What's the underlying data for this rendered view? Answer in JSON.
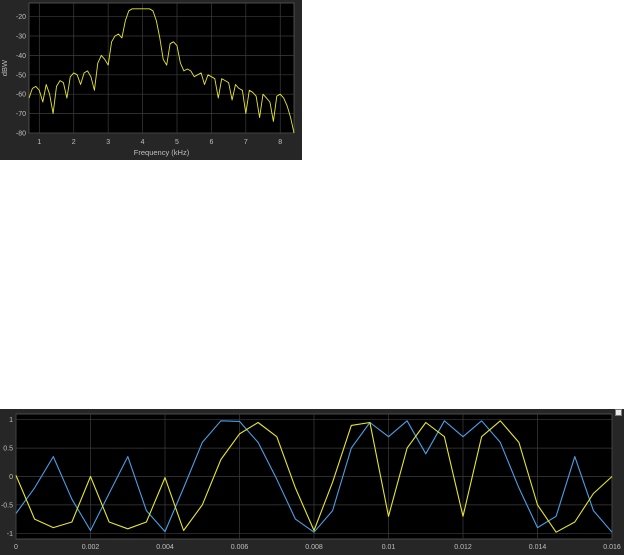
{
  "spectrum_scope": {
    "chart_data": {
      "type": "line",
      "title": "",
      "xlabel": "Frequency (kHz)",
      "ylabel": "dBW",
      "xlim": [
        0.7,
        8.4
      ],
      "ylim": [
        -80,
        -13
      ],
      "x_ticks": [
        "1",
        "2",
        "3",
        "4",
        "5",
        "6",
        "7",
        "8"
      ],
      "y_ticks": [
        "-20",
        "-30",
        "-40",
        "-50",
        "-60",
        "-70",
        "-80"
      ],
      "grid": true,
      "series": [
        {
          "color": "#e6e62e",
          "x": [
            0.7,
            0.8,
            0.9,
            1.0,
            1.1,
            1.2,
            1.3,
            1.4,
            1.5,
            1.6,
            1.7,
            1.8,
            1.9,
            2.0,
            2.1,
            2.2,
            2.3,
            2.4,
            2.5,
            2.6,
            2.7,
            2.8,
            2.9,
            3.0,
            3.1,
            3.2,
            3.3,
            3.4,
            3.5,
            3.6,
            3.7,
            3.8,
            3.9,
            4.0,
            4.1,
            4.2,
            4.3,
            4.4,
            4.5,
            4.6,
            4.7,
            4.8,
            4.9,
            5.0,
            5.1,
            5.2,
            5.3,
            5.4,
            5.5,
            5.6,
            5.7,
            5.8,
            5.9,
            6.0,
            6.1,
            6.2,
            6.3,
            6.4,
            6.5,
            6.6,
            6.7,
            6.8,
            6.9,
            7.0,
            7.1,
            7.2,
            7.3,
            7.4,
            7.5,
            7.6,
            7.7,
            7.8,
            7.9,
            8.0,
            8.1,
            8.2,
            8.3,
            8.4
          ],
          "y": [
            -62,
            -57,
            -56,
            -58,
            -64,
            -55,
            -60,
            -70,
            -56,
            -53,
            -54,
            -62,
            -51,
            -49,
            -50,
            -55,
            -49,
            -48,
            -51,
            -58,
            -44,
            -40,
            -42,
            -45,
            -33,
            -30,
            -29,
            -31,
            -22,
            -17,
            -16,
            -16,
            -16,
            -16,
            -16,
            -16,
            -17,
            -22,
            -31,
            -42,
            -45,
            -34,
            -33,
            -35,
            -44,
            -48,
            -47,
            -48,
            -51,
            -50,
            -49,
            -55,
            -50,
            -51,
            -52,
            -62,
            -52,
            -53,
            -54,
            -63,
            -55,
            -57,
            -58,
            -70,
            -58,
            -59,
            -61,
            -72,
            -60,
            -62,
            -64,
            -74,
            -61,
            -60,
            -62,
            -66,
            -72,
            -80
          ]
        }
      ]
    }
  },
  "time_scope": {
    "chart_data": {
      "type": "line",
      "title": "",
      "xlabel": "",
      "ylabel": "",
      "xlim": [
        0,
        0.016
      ],
      "ylim": [
        -1.1,
        1.1
      ],
      "x_ticks": [
        "0",
        "0.002",
        "0.004",
        "0.006",
        "0.008",
        "0.01",
        "0.012",
        "0.014",
        "0.016"
      ],
      "y_ticks": [
        "1",
        "0.5",
        "0",
        "-0.5",
        "-1"
      ],
      "grid": true,
      "series": [
        {
          "color": "#4a9fe8",
          "x": [
            0,
            0.0005,
            0.001,
            0.0015,
            0.002,
            0.0025,
            0.003,
            0.0035,
            0.004,
            0.0045,
            0.005,
            0.0055,
            0.006,
            0.0065,
            0.007,
            0.0075,
            0.008,
            0.0085,
            0.009,
            0.0095,
            0.01,
            0.0105,
            0.011,
            0.0115,
            0.012,
            0.0125,
            0.013,
            0.0135,
            0.014,
            0.0145,
            0.015,
            0.0155,
            0.016
          ],
          "y": [
            -0.65,
            -0.2,
            0.35,
            -0.4,
            -0.95,
            -0.3,
            0.35,
            -0.6,
            -0.97,
            -0.2,
            0.6,
            0.98,
            0.97,
            0.6,
            -0.05,
            -0.75,
            -0.98,
            -0.6,
            0.5,
            0.95,
            0.7,
            0.98,
            0.4,
            0.98,
            0.7,
            0.98,
            0.6,
            -0.2,
            -0.9,
            -0.7,
            0.35,
            -0.6,
            -0.98
          ]
        },
        {
          "color": "#e6e62e",
          "x": [
            0,
            0.0005,
            0.001,
            0.0015,
            0.002,
            0.0025,
            0.003,
            0.0035,
            0.004,
            0.0045,
            0.005,
            0.0055,
            0.006,
            0.0065,
            0.007,
            0.0075,
            0.008,
            0.0085,
            0.009,
            0.0095,
            0.01,
            0.0105,
            0.011,
            0.0115,
            0.012,
            0.0125,
            0.013,
            0.0135,
            0.014,
            0.0145,
            0.015,
            0.0155,
            0.016
          ],
          "y": [
            0.02,
            -0.75,
            -0.9,
            -0.8,
            0.0,
            -0.8,
            -0.92,
            -0.8,
            -0.02,
            -0.95,
            -0.5,
            0.3,
            0.75,
            0.95,
            0.7,
            -0.2,
            -0.95,
            -0.1,
            0.9,
            0.95,
            -0.7,
            0.5,
            0.95,
            0.7,
            -0.7,
            0.7,
            0.98,
            0.6,
            -0.5,
            -0.98,
            -0.8,
            -0.3,
            0.0
          ]
        }
      ]
    }
  }
}
